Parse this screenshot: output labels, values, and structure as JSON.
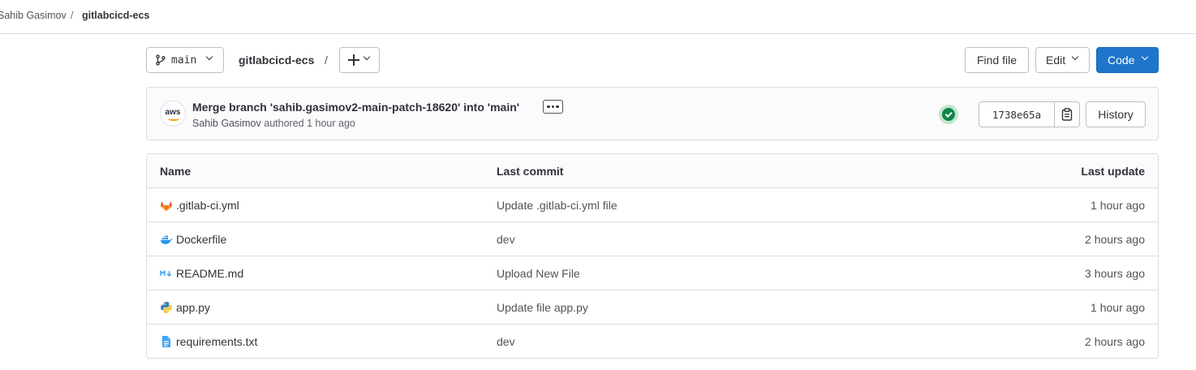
{
  "breadcrumb": {
    "owner": "Sahib Gasimov",
    "separator": "/",
    "project": "gitlabcicd-ecs"
  },
  "toolbar": {
    "branch": "main",
    "repo_path": "gitlabcicd-ecs",
    "path_separator": "/",
    "find_file_label": "Find file",
    "edit_label": "Edit",
    "code_label": "Code"
  },
  "last_commit": {
    "avatar_text": "aws",
    "title": "Merge branch 'sahib.gasimov2-main-patch-18620' into 'main'",
    "author": "Sahib Gasimov",
    "authored_text": "authored 1 hour ago",
    "pipeline_status": "passed",
    "sha": "1738e65a",
    "history_label": "History"
  },
  "file_table": {
    "headers": {
      "name": "Name",
      "last_commit": "Last commit",
      "last_update": "Last update"
    },
    "rows": [
      {
        "name": ".gitlab-ci.yml",
        "icon": "gitlab-icon",
        "commit": "Update .gitlab-ci.yml file",
        "updated": "1 hour ago"
      },
      {
        "name": "Dockerfile",
        "icon": "docker-icon",
        "commit": "dev",
        "updated": "2 hours ago"
      },
      {
        "name": "README.md",
        "icon": "markdown-icon",
        "commit": "Upload New File",
        "updated": "3 hours ago"
      },
      {
        "name": "app.py",
        "icon": "python-icon",
        "commit": "Update file app.py",
        "updated": "1 hour ago"
      },
      {
        "name": "requirements.txt",
        "icon": "text-file-icon",
        "commit": "dev",
        "updated": "2 hours ago"
      }
    ]
  },
  "colors": {
    "primary": "#1f75cb",
    "success": "#108548",
    "border": "#dcdcde"
  }
}
